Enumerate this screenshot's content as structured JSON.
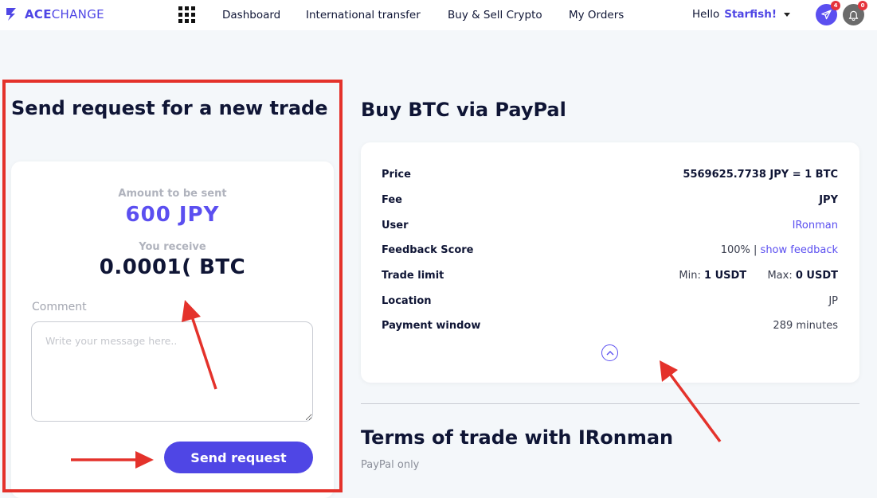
{
  "app": {
    "logo_bold": "ACE",
    "logo_thin": "CHANGE",
    "brand_color": "#4f46e5"
  },
  "nav": {
    "apps_icon": "grid-icon",
    "items": [
      "Dashboard",
      "International transfer",
      "Buy & Sell Crypto",
      "My Orders"
    ]
  },
  "user": {
    "greeting": "Hello",
    "name": "Starfish!",
    "messages_badge": "4",
    "notifications_badge": "0"
  },
  "trade_request": {
    "heading": "Send request for a new trade",
    "amount_label": "Amount to be sent",
    "amount_value": "600 JPY",
    "receive_label": "You receive",
    "receive_value": "0.0001( BTC",
    "comment_label": "Comment",
    "comment_placeholder": "Write your message here..",
    "comment_value": "",
    "send_button": "Send request"
  },
  "offer": {
    "heading": "Buy BTC via PayPal",
    "rows": {
      "price": {
        "label": "Price",
        "value": "5569625.7738 JPY = 1 BTC"
      },
      "fee": {
        "label": "Fee",
        "value": "JPY"
      },
      "user": {
        "label": "User",
        "value": "IRonman"
      },
      "feedback": {
        "label": "Feedback Score",
        "score": "100%",
        "sep": "|",
        "link": "show feedback"
      },
      "limit": {
        "label": "Trade limit",
        "min_label": "Min:",
        "min_value": "1 USDT",
        "max_label": "Max:",
        "max_value": "0 USDT"
      },
      "location": {
        "label": "Location",
        "value": "JP"
      },
      "payment_window": {
        "label": "Payment window",
        "value": "289 minutes"
      }
    },
    "collapse_icon": "chevron-up-icon"
  },
  "terms": {
    "heading": "Terms of trade with IRonman",
    "text": "PayPal only"
  },
  "annotation_color": "#e4322b"
}
